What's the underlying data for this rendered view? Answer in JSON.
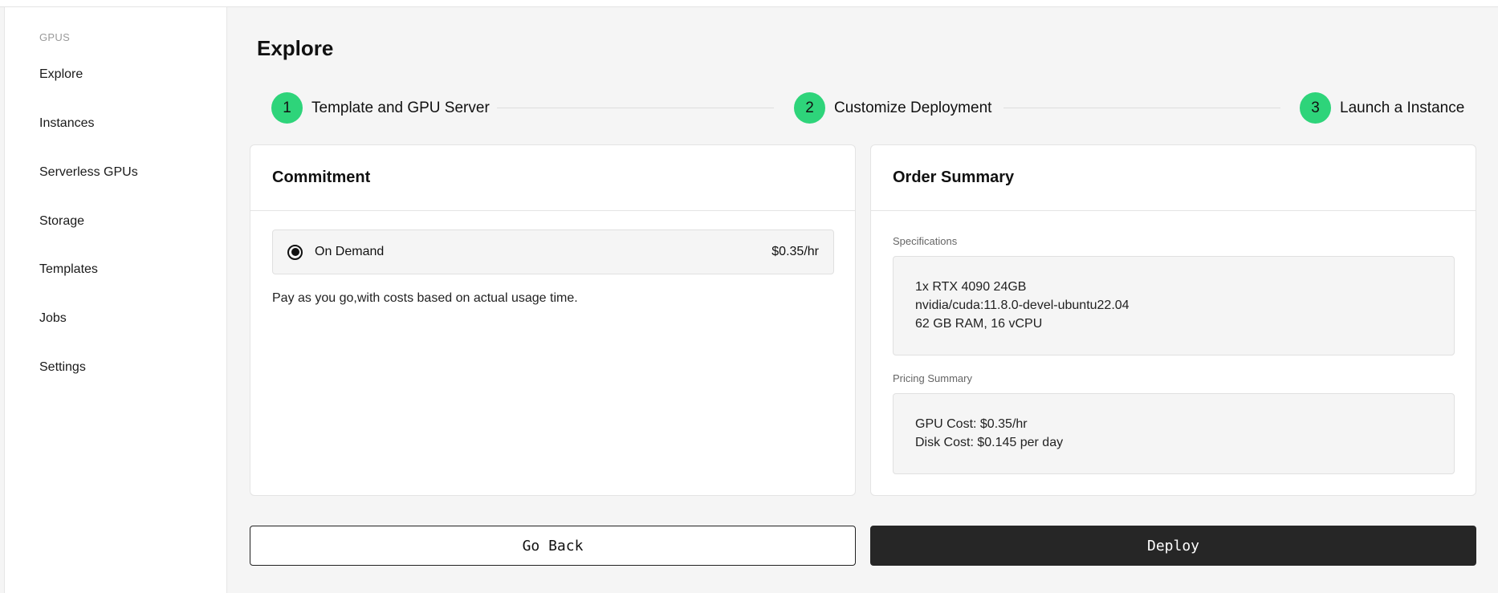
{
  "sidebar": {
    "section": "GPUS",
    "items": [
      {
        "label": "Explore"
      },
      {
        "label": "Instances"
      },
      {
        "label": "Serverless GPUs"
      },
      {
        "label": "Storage"
      },
      {
        "label": "Templates"
      },
      {
        "label": "Jobs"
      },
      {
        "label": "Settings"
      }
    ]
  },
  "main": {
    "title": "Explore",
    "steps": [
      {
        "number": "1",
        "label": "Template and GPU Server"
      },
      {
        "number": "2",
        "label": "Customize Deployment"
      },
      {
        "number": "3",
        "label": "Launch a Instance"
      }
    ],
    "commitment": {
      "title": "Commitment",
      "option_label": "On Demand",
      "option_price": "$0.35/hr",
      "option_selected": true,
      "description": "Pay as you go,with costs based on actual usage time."
    },
    "order_summary": {
      "title": "Order Summary",
      "specs_label": "Specifications",
      "specs": [
        "1x RTX 4090 24GB",
        "nvidia/cuda:11.8.0-devel-ubuntu22.04",
        "62 GB RAM, 16 vCPU"
      ],
      "pricing_label": "Pricing Summary",
      "pricing": [
        "GPU Cost: $0.35/hr",
        "Disk Cost: $0.145 per day"
      ]
    },
    "buttons": {
      "back": "Go Back",
      "deploy": "Deploy"
    }
  },
  "colors": {
    "accent": "#2ed47a",
    "background": "#f5f5f5",
    "primary_button": "#262626"
  }
}
